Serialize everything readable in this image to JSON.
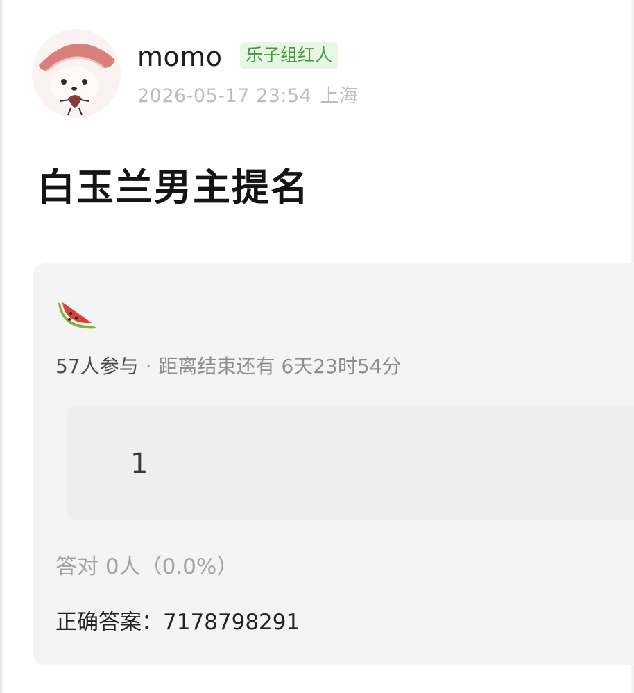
{
  "author": {
    "name": "momo",
    "badge": "乐子组红人",
    "timestamp": "2026-05-17 23:54",
    "location": "上海"
  },
  "post": {
    "title": "白玉兰男主提名"
  },
  "quiz": {
    "icon": "watermelon-slice-icon",
    "participants": "57人参与",
    "separator": "·",
    "remaining": "距离结束还有 6天23时54分",
    "options": [
      {
        "text": "1"
      }
    ],
    "correct_rate": "答对  0人（0.0%）",
    "correct_answer": "正确答案：7178798291"
  },
  "colors": {
    "badge_bg": "#e8f7e4",
    "badge_text": "#3e9b3a",
    "card_bg": "#f4f4f4",
    "option_bg": "#eeeeee",
    "watermelon_red": "#d9403c"
  }
}
